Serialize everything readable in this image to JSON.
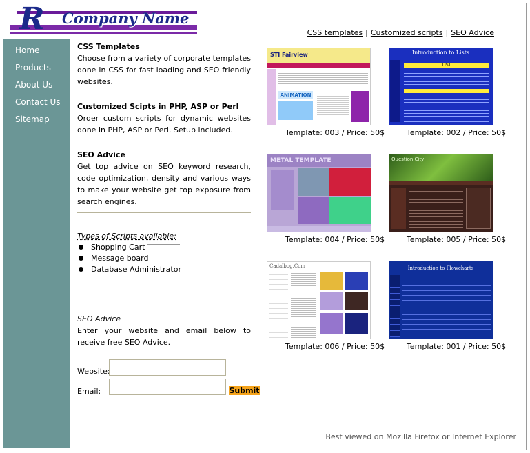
{
  "header": {
    "logo_text": "Company Name",
    "top_links": [
      "CSS templates",
      "Customized scripts",
      "SEO Advice"
    ],
    "separator": "|"
  },
  "sidebar": {
    "items": [
      "Home",
      "Products",
      "About Us",
      "Contact Us",
      "Sitemap"
    ]
  },
  "main": {
    "sections": [
      {
        "title": "CSS Templates",
        "body": "Choose from a variety of corporate templates done in CSS for fast loading and SEO friendly websites."
      },
      {
        "title": "Customized Scipts in PHP, ASP or Perl",
        "body": "Order custom scripts for dynamic websites done in PHP, ASP or Perl. Setup included."
      },
      {
        "title": "SEO Advice",
        "body": "Get top advice on SEO keyword research, code optimization, density and various ways to make your website get top exposure from search engines."
      }
    ],
    "scripts_heading": "Types of Scripts available:",
    "scripts": [
      "Shopping Cart",
      "Message board",
      "Database Administrator"
    ],
    "seo_form": {
      "heading": "SEO Advice",
      "intro": "Enter your website and email below to receive free SEO Advice.",
      "website_label": "Website:",
      "email_label": "Email:",
      "website_value": "",
      "email_value": "",
      "submit_label": "Submit"
    }
  },
  "templates": [
    {
      "caption": "Template: 003 / Price: 50$",
      "brand": "STI Fairview",
      "banner": "ANIMATION"
    },
    {
      "caption": "Template: 002 / Price: 50$",
      "title": "Introduction to Lists",
      "box": "LIST"
    },
    {
      "caption": "Template: 004 / Price: 50$",
      "title": "METAL TEMPLATE"
    },
    {
      "caption": "Template: 005 / Price: 50$",
      "title": "Question City"
    },
    {
      "caption": "Template: 006 / Price: 50$",
      "title": "Cadalbog.Com"
    },
    {
      "caption": "Template: 001 / Price: 50$",
      "title": "Introduction to Flowcharts"
    }
  ],
  "footer": {
    "text": "Best viewed on Mozilla Firefox or Internet Explorer"
  },
  "colors": {
    "sidebar": "#6b9696",
    "logo_bar": "#7b2aa8",
    "logo_text": "#1b2a8a",
    "submit": "#f5a31a",
    "divider": "#b8b49b"
  }
}
